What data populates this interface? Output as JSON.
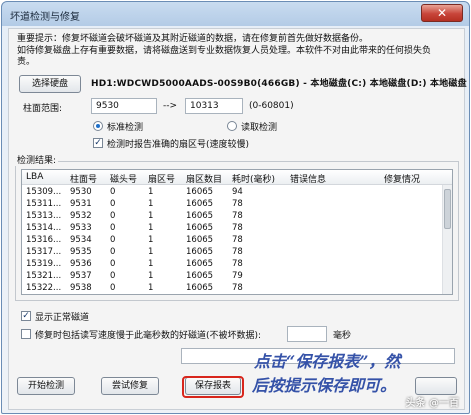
{
  "window": {
    "title": "坏道检测与修复",
    "close_label": "✕"
  },
  "notice": {
    "line1": "重要提示：修复坏磁道会破坏磁道及其附近磁道的数据，请在修复前首先做好数据备份。",
    "line2": "如待修复磁盘上存有重要数据，请将磁盘送到专业数据恢复人员处理。本软件不对由此带来的任何损失负",
    "line3": "责。"
  },
  "disk": {
    "select_button": "选择硬盘",
    "label": "HD1:WDCWD5000AADS-00S9B0(466GB) - 本地磁盘(C:) 本地磁盘(D:) 本地磁盘"
  },
  "range": {
    "label": "柱面范围:",
    "start": "9530",
    "arrow": "-->",
    "end": "10313",
    "hint": "(0-60801)"
  },
  "mode": {
    "standard": "标准检测",
    "standard_checked": true,
    "read": "读取检测",
    "read_checked": false,
    "report_sector": "检测时报告准确的扇区号(速度较慢)",
    "report_sector_checked": true
  },
  "results": {
    "group_title": "检测结果:",
    "columns": [
      "LBA",
      "柱面号",
      "磁头号",
      "扇区号",
      "扇区数目",
      "耗时(毫秒)",
      "错误信息",
      "修复情况"
    ],
    "rows": [
      [
        "15309...",
        "9530",
        "0",
        "1",
        "16065",
        "94",
        "",
        ""
      ],
      [
        "15311...",
        "9531",
        "0",
        "1",
        "16065",
        "78",
        "",
        ""
      ],
      [
        "15313...",
        "9532",
        "0",
        "1",
        "16065",
        "78",
        "",
        ""
      ],
      [
        "15314...",
        "9533",
        "0",
        "1",
        "16065",
        "78",
        "",
        ""
      ],
      [
        "15316...",
        "9534",
        "0",
        "1",
        "16065",
        "78",
        "",
        ""
      ],
      [
        "15317...",
        "9535",
        "0",
        "1",
        "16065",
        "78",
        "",
        ""
      ],
      [
        "15319...",
        "9536",
        "0",
        "1",
        "16065",
        "78",
        "",
        ""
      ],
      [
        "15321...",
        "9537",
        "0",
        "1",
        "16065",
        "79",
        "",
        ""
      ],
      [
        "15322...",
        "9538",
        "0",
        "1",
        "16065",
        "78",
        "",
        ""
      ]
    ]
  },
  "options": {
    "show_normal": "显示正常磁道",
    "show_normal_checked": true,
    "repair_slow": "修复时包括读写速度慢于此毫秒数的好磁道(不被坏数据):",
    "repair_slow_checked": false,
    "ms_unit": "毫秒"
  },
  "buttons": {
    "start": "开始检测",
    "try_repair": "尝试修复",
    "save_report": "保存报表"
  },
  "annotation": {
    "line1": "点击“保存报表”，然",
    "line2": "后按提示保存即可。"
  },
  "watermark": "头条 @一百"
}
